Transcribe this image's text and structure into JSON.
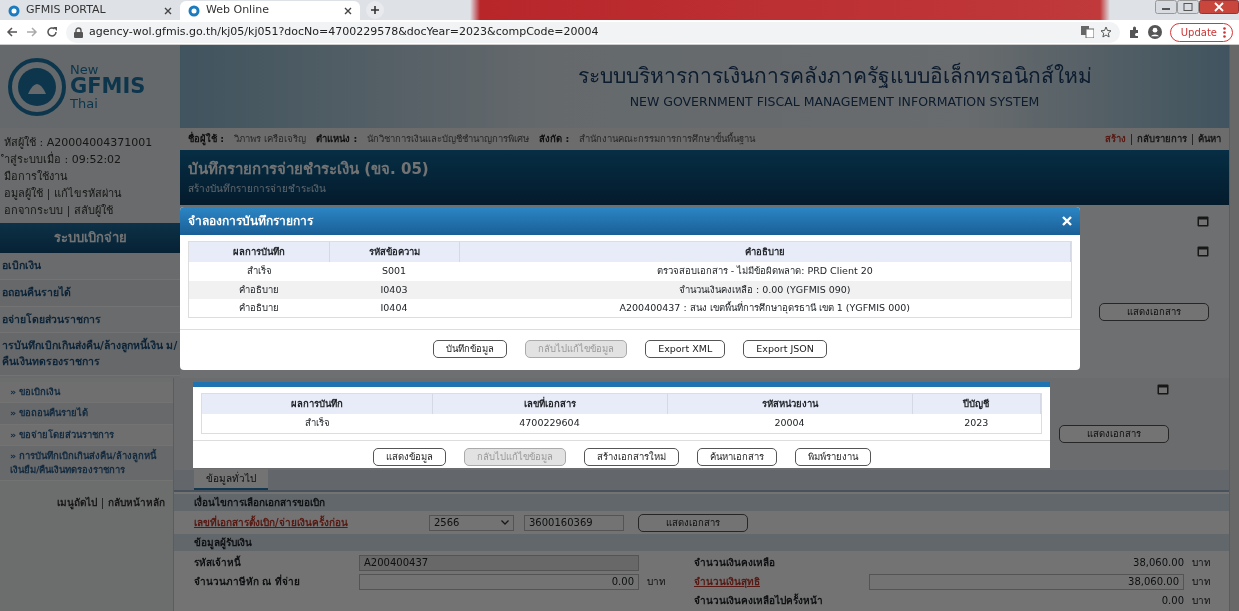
{
  "browser": {
    "tabs": [
      {
        "label": "GFMIS PORTAL",
        "selected": false
      },
      {
        "label": "Web Online",
        "selected": true
      }
    ],
    "address": "agency-wol.gfmis.go.th/kj05/kj051?docNo=4700229578&docYear=2023&compCode=20004",
    "update_button": "Update"
  },
  "header": {
    "logo": [
      "New",
      "GFMIS",
      "Thai"
    ],
    "title": "ระบบบริหารการเงินการคลังภาครัฐแบบอิเล็กทรอนิกส์ใหม่",
    "subtitle": "NEW GOVERNMENT FISCAL MANAGEMENT INFORMATION SYSTEM"
  },
  "user_info": {
    "lines": [
      "หัสผู้ใช้ : A20004004371001",
      "ำสู่ระบบเมื่อ : 09:52:02",
      "มือการใช้งาน"
    ],
    "link_rows": [
      [
        "อมูลผู้ใช้",
        "แก้ไขรหัสผ่าน"
      ],
      [
        "อกจากระบบ",
        "สลับผู้ใช้"
      ]
    ]
  },
  "user_bar": {
    "fields": [
      {
        "label": "ชื่อผู้ใช้ :",
        "value": "วิภาพร เครือเจริญ"
      },
      {
        "label": "ตำแหน่ง :",
        "value": "นักวิชาการเงินและบัญชีชำนาญการพิเศษ"
      },
      {
        "label": "สังกัด :",
        "value": "สำนักงานคณะกรรมการการศึกษาขั้นพื้นฐาน"
      }
    ],
    "actions": [
      {
        "label": "สร้าง",
        "selected": true
      },
      {
        "label": "กลับรายการ",
        "selected": false
      },
      {
        "label": "ค้นหา",
        "selected": false
      }
    ]
  },
  "sidebar": {
    "title": "ระบบเบิกจ่าย",
    "items": [
      "อเบิกเงิน",
      "อถอนคืนรายได้",
      "อจ่ายโดยส่วนราชการ",
      "ารบันทึกเบิกเกินส่งคืน/ล้างลูกหนี้เงิน ม/คืนเงินทดรองราชการ"
    ]
  },
  "page_title": {
    "title": "บันทึกรายการจ่ายชำระเงิน (ขจ. 05)",
    "subtitle": "สร้างบันทึกรายการจ่ายชำระเงิน"
  },
  "upper_button": "แสดงเอกสาร",
  "dialog": {
    "title": "จำลองการบันทึกรายการ",
    "columns": [
      "ผลการบันทึก",
      "รหัสข้อความ",
      "คำอธิบาย"
    ],
    "rows": [
      [
        "สำเร็จ",
        "S001",
        "ตรวจสอบเอกสาร - ไม่มีข้อผิดพลาด: PRD Client 20"
      ],
      [
        "คำอธิบาย",
        "I0403",
        "จำนวนเงินคงเหลือ : 0.00 (YGFMIS 090)"
      ],
      [
        "คำอธิบาย",
        "I0404",
        "A200400437 : สนง เขตพื้นที่การศึกษาอุดรธานี เขต 1 (YGFMIS 000)"
      ]
    ],
    "buttons": [
      {
        "label": "บันทึกข้อมูล",
        "disabled": false
      },
      {
        "label": "กลับไปแก้ไขข้อมูล",
        "disabled": true
      },
      {
        "label": "Export XML",
        "disabled": false
      },
      {
        "label": "Export JSON",
        "disabled": false
      }
    ]
  },
  "lower_sidebar": {
    "items": [
      "» ขอเบิกเงิน",
      "» ขอถอนคืนรายได้",
      "» ขอจ่ายโดยส่วนราชการ",
      "» การบันทึกเบิกเกินส่งคืน/ล้างลูกหนี้เงินยืม/คืนเงินทดรองราชการ"
    ],
    "footer": [
      "เมนูถัดไป",
      "กลับหน้าหลัก"
    ]
  },
  "lower_button": "แสดงเอกสาร",
  "form": {
    "tab": "ข้อมูลทั่วไป",
    "selection": {
      "title": "เงื่อนไขการเลือกเอกสารขอเบิก",
      "link": "เลขที่เอกสารตั้งเบิก/จ่ายเงินครั้งก่อน",
      "year": "2566",
      "doc_no": "3600160369",
      "button": "แสดงเอกสาร"
    },
    "payee": {
      "title": "ข้อมูลผู้รับเงิน",
      "left": [
        {
          "label": "รหัสเจ้าหนี้",
          "value": "A200400437",
          "kind": "readonly"
        },
        {
          "label": "จำนวนภาษีหัก ณ ที่จ่าย",
          "value": "0.00",
          "unit": "บาท",
          "kind": "input"
        }
      ],
      "right": [
        {
          "label": "จำนวนเงินคงเหลือ",
          "value": "38,060.00",
          "unit": "บาท",
          "kind": "text",
          "link": false
        },
        {
          "label": "จำนวนเงินสุทธิ",
          "value": "38,060.00",
          "unit": "บาท",
          "kind": "input",
          "link": true
        },
        {
          "label": "จำนวนเงินคงเหลือไปครั้งหน้า",
          "value": "0.00",
          "unit": "บาท",
          "kind": "text",
          "link": false
        }
      ]
    }
  },
  "result_dialog": {
    "columns": [
      "ผลการบันทึก",
      "เลขที่เอกสาร",
      "รหัสหน่วยงาน",
      "ปีบัญชี"
    ],
    "rows": [
      [
        "สำเร็จ",
        "4700229604",
        "20004",
        "2023"
      ]
    ],
    "buttons": [
      {
        "label": "แสดงข้อมูล",
        "disabled": false
      },
      {
        "label": "กลับไปแก้ไขข้อมูล",
        "disabled": true
      },
      {
        "label": "สร้างเอกสารใหม่",
        "disabled": false
      },
      {
        "label": "ค้นหาเอกสาร",
        "disabled": false
      },
      {
        "label": "พิมพ์รายงาน",
        "disabled": false
      }
    ]
  }
}
